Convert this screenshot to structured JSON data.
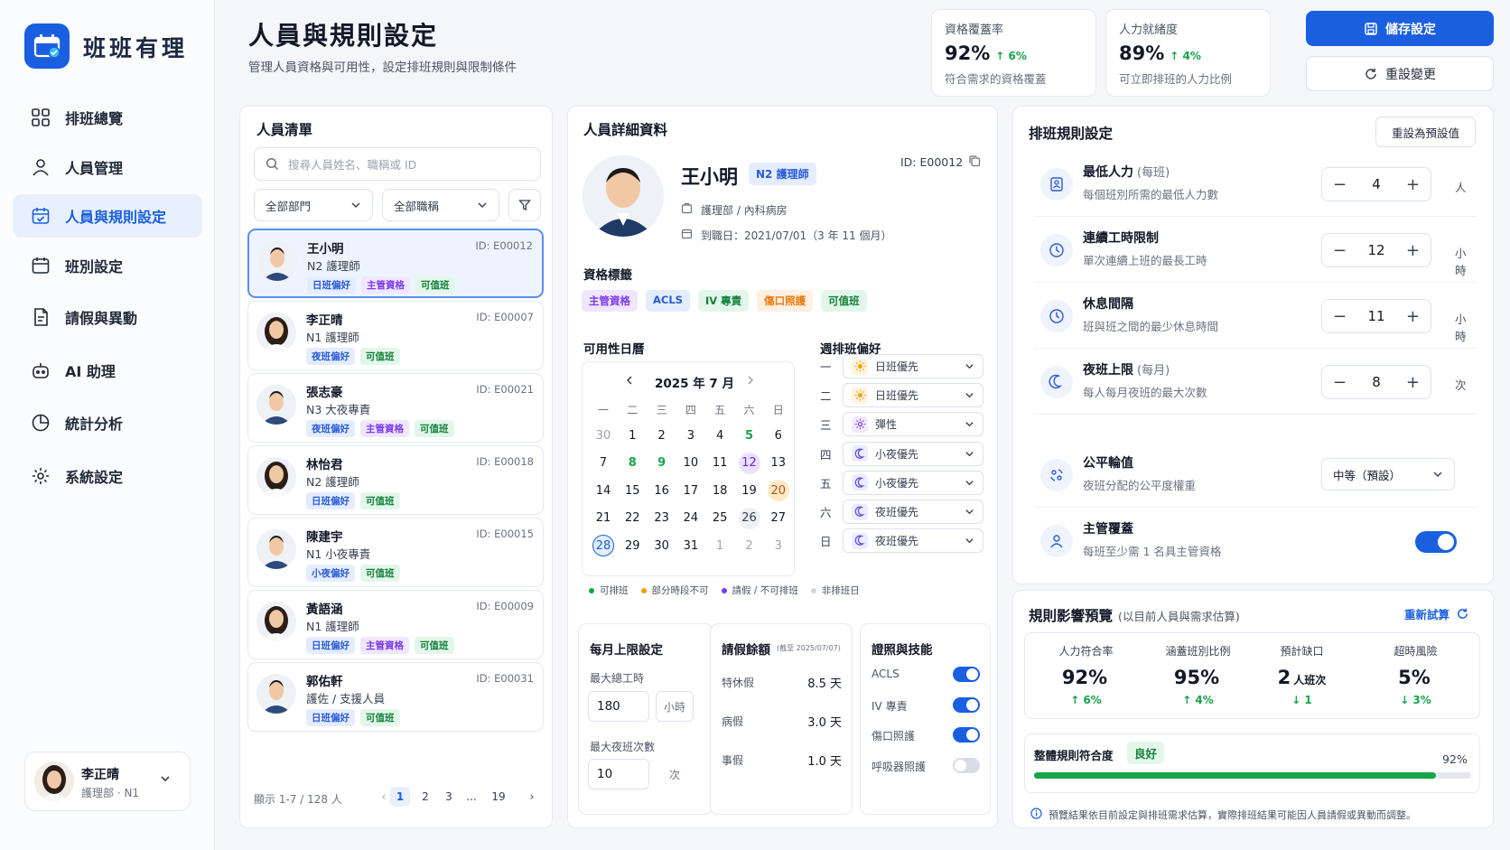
{
  "app": {
    "name": "班班有理",
    "brand_color": "#1a5fe0"
  },
  "nav": [
    {
      "label": "排班總覽",
      "icon": "grid-icon"
    },
    {
      "label": "人員管理",
      "icon": "user-icon"
    },
    {
      "label": "人員與規則設定",
      "icon": "calendar-check-icon",
      "active": true
    },
    {
      "label": "班別設定",
      "icon": "calendar-icon"
    },
    {
      "label": "請假與異動",
      "icon": "document-icon"
    },
    {
      "label": "AI 助理",
      "icon": "robot-icon"
    },
    {
      "label": "統計分析",
      "icon": "pie-chart-icon"
    },
    {
      "label": "系統設定",
      "icon": "gear-icon"
    }
  ],
  "current_user": {
    "name": "李正晴",
    "role": "護理部 · N1"
  },
  "header": {
    "title": "人員與規則設定",
    "subtitle": "管理人員資格與可用性，設定排班規則與限制條件",
    "stats": [
      {
        "title": "資格覆蓋率",
        "value": "92%",
        "change": "↑ 6%",
        "desc": "符合需求的資格覆蓋"
      },
      {
        "title": "人力就緒度",
        "value": "89%",
        "change": "↑ 4%",
        "desc": "可立即排班的人力比例"
      }
    ],
    "save_label": "儲存設定",
    "reset_label": "重設變更"
  },
  "people": {
    "title": "人員清單",
    "search_placeholder": "搜尋人員姓名、職稱或 ID",
    "dept_filter": "全部部門",
    "title_filter": "全部職稱",
    "list": [
      {
        "name": "王小明",
        "role": "N2 護理師",
        "id": "ID: E00012",
        "tags": [
          [
            "日班偏好",
            "blue"
          ],
          [
            "主管資格",
            "purple"
          ],
          [
            "可值班",
            "green"
          ]
        ],
        "selected": true
      },
      {
        "name": "李正晴",
        "role": "N1 護理師",
        "id": "ID: E00007",
        "tags": [
          [
            "夜班偏好",
            "blue"
          ],
          [
            "可值班",
            "green"
          ]
        ]
      },
      {
        "name": "張志豪",
        "role": "N3 大夜專責",
        "id": "ID: E00021",
        "tags": [
          [
            "夜班偏好",
            "blue"
          ],
          [
            "主管資格",
            "purple"
          ],
          [
            "可值班",
            "green"
          ]
        ]
      },
      {
        "name": "林怡君",
        "role": "N2 護理師",
        "id": "ID: E00018",
        "tags": [
          [
            "日班偏好",
            "blue"
          ],
          [
            "可值班",
            "green"
          ]
        ]
      },
      {
        "name": "陳建宇",
        "role": "N1 小夜專責",
        "id": "ID: E00015",
        "tags": [
          [
            "小夜偏好",
            "blue"
          ],
          [
            "可值班",
            "green"
          ]
        ]
      },
      {
        "name": "黃語涵",
        "role": "N1 護理師",
        "id": "ID: E00009",
        "tags": [
          [
            "日班偏好",
            "blue"
          ],
          [
            "主管資格",
            "purple"
          ],
          [
            "可值班",
            "green"
          ]
        ]
      },
      {
        "name": "郭佑軒",
        "role": "護佐 / 支援人員",
        "id": "ID: E00031",
        "tags": [
          [
            "日班偏好",
            "blue"
          ],
          [
            "可值班",
            "green"
          ]
        ]
      }
    ],
    "footer": "顯示 1-7 / 128 人",
    "pages": [
      "1",
      "2",
      "3",
      "...",
      "19"
    ]
  },
  "detail": {
    "title": "人員詳細資料",
    "name": "王小明",
    "level": "N2 護理師",
    "id": "ID: E00012",
    "dept": "護理部 / 內科病房",
    "joined": "到職日：2021/07/01（3 年 11 個月）",
    "qual_title": "資格標籤",
    "quals": [
      [
        "主管資格",
        "purple"
      ],
      [
        "ACLS",
        "blue"
      ],
      [
        "IV 專責",
        "green"
      ],
      [
        "傷口照護",
        "orange"
      ],
      [
        "可值班",
        "green"
      ]
    ],
    "cal_title": "可用性日曆",
    "cal_month": "2025 年 7 月",
    "weekdays": [
      "一",
      "二",
      "三",
      "四",
      "五",
      "六",
      "日"
    ],
    "cal_days": [
      [
        "30",
        "o"
      ],
      [
        "1",
        ""
      ],
      [
        "2",
        ""
      ],
      [
        "3",
        ""
      ],
      [
        "4",
        ""
      ],
      [
        "5",
        "g"
      ],
      [
        "6",
        ""
      ],
      [
        "7",
        ""
      ],
      [
        "8",
        "g"
      ],
      [
        "9",
        "g"
      ],
      [
        "10",
        ""
      ],
      [
        "11",
        ""
      ],
      [
        "12",
        "p"
      ],
      [
        "13",
        ""
      ],
      [
        "14",
        ""
      ],
      [
        "15",
        ""
      ],
      [
        "16",
        ""
      ],
      [
        "17",
        ""
      ],
      [
        "18",
        ""
      ],
      [
        "19",
        ""
      ],
      [
        "20",
        "y"
      ],
      [
        "21",
        ""
      ],
      [
        "22",
        ""
      ],
      [
        "23",
        ""
      ],
      [
        "24",
        ""
      ],
      [
        "25",
        ""
      ],
      [
        "26",
        "gr"
      ],
      [
        "27",
        ""
      ],
      [
        "28",
        "b"
      ],
      [
        "29",
        ""
      ],
      [
        "30",
        ""
      ],
      [
        "31",
        ""
      ],
      [
        "1",
        "o"
      ],
      [
        "2",
        "o"
      ],
      [
        "3",
        "o"
      ]
    ],
    "pref_title": "週排班偏好",
    "prefs": [
      {
        "day": "一",
        "value": "日班優先",
        "icon": "sun"
      },
      {
        "day": "二",
        "value": "日班優先",
        "icon": "sun"
      },
      {
        "day": "三",
        "value": "彈性",
        "icon": "flex"
      },
      {
        "day": "四",
        "value": "小夜優先",
        "icon": "moon"
      },
      {
        "day": "五",
        "value": "小夜優先",
        "icon": "moon"
      },
      {
        "day": "六",
        "value": "夜班優先",
        "icon": "moon"
      },
      {
        "day": "日",
        "value": "夜班優先",
        "icon": "moon"
      }
    ],
    "legend": [
      {
        "label": "可排班",
        "color": "#16a34a"
      },
      {
        "label": "部分時段不可",
        "color": "#f59e0b"
      },
      {
        "label": "請假 / 不可排班",
        "color": "#7c3aed"
      },
      {
        "label": "非排班日",
        "color": "#d1d5db"
      }
    ],
    "monthly": {
      "title": "每月上限設定",
      "hours_label": "最大總工時",
      "hours": "180",
      "hours_unit": "小時",
      "nights_label": "最大夜班次數",
      "nights": "10",
      "nights_unit": "次"
    },
    "leave": {
      "title": "請假餘額",
      "asof": "(截至 2025/07/07)",
      "items": [
        {
          "label": "特休假",
          "value": "8.5 天"
        },
        {
          "label": "病假",
          "value": "3.0 天"
        },
        {
          "label": "事假",
          "value": "1.0 天"
        }
      ]
    },
    "certs": {
      "title": "證照與技能",
      "items": [
        {
          "label": "ACLS",
          "on": true
        },
        {
          "label": "IV 專責",
          "on": true
        },
        {
          "label": "傷口照護",
          "on": true
        },
        {
          "label": "呼吸器照護",
          "on": false
        }
      ]
    }
  },
  "rules": {
    "title": "排班規則設定",
    "reset_default": "重設為預設值",
    "items": [
      {
        "title": "最低人力",
        "note": "(每班)",
        "desc": "每個班別所需的最低人力數",
        "value": "4",
        "unit": "人",
        "icon": "staff-icon"
      },
      {
        "title": "連續工時限制",
        "note": "",
        "desc": "單次連續上班的最長工時",
        "value": "12",
        "unit": "小時",
        "icon": "clock-icon"
      },
      {
        "title": "休息間隔",
        "note": "",
        "desc": "班與班之間的最少休息時間",
        "value": "11",
        "unit": "小時",
        "icon": "clock-icon"
      },
      {
        "title": "夜班上限",
        "note": "(每月)",
        "desc": "每人每月夜班的最大次數",
        "value": "8",
        "unit": "次",
        "icon": "moon-icon"
      }
    ],
    "fairness": {
      "title": "公平輪值",
      "desc": "夜班分配的公平度權重",
      "value": "中等（預設）"
    },
    "supervisor": {
      "title": "主管覆蓋",
      "desc": "每班至少需 1 名具主管資格",
      "on": true
    }
  },
  "preview": {
    "title": "規則影響預覽",
    "subtitle": "(以目前人員與需求估算)",
    "recalc": "重新試算",
    "metrics": [
      {
        "label": "人力符合率",
        "value": "92%",
        "unit": "",
        "change": "↑ 6%",
        "color": "#16a34a"
      },
      {
        "label": "涵蓋班別比例",
        "value": "95%",
        "unit": "",
        "change": "↑ 4%",
        "color": "#16a34a"
      },
      {
        "label": "預計缺口",
        "value": "2",
        "unit": "人班次",
        "change": "↓ 1",
        "color": "#16a34a"
      },
      {
        "label": "超時風險",
        "value": "5%",
        "unit": "",
        "change": "↓ 3%",
        "color": "#16a34a"
      }
    ],
    "compliance_label": "整體規則符合度",
    "compliance_badge": "良好",
    "compliance_value": "92%",
    "compliance_fraction": 0.92,
    "note": "預覽結果依目前設定與排班需求估算，實際排班結果可能因人員請假或異動而調整。"
  }
}
